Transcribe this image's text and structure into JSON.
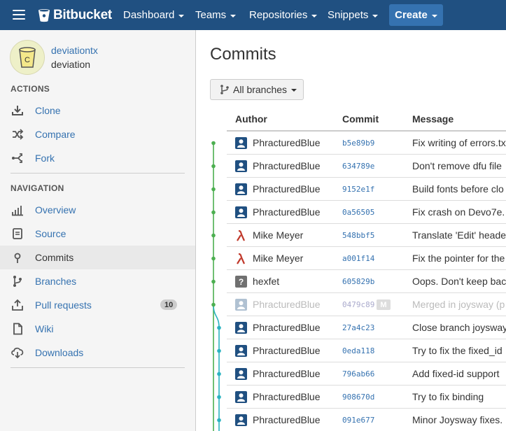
{
  "nav": {
    "brand": "Bitbucket",
    "items": [
      "Dashboard",
      "Teams",
      "Repositories",
      "Snippets"
    ],
    "create_label": "Create"
  },
  "repo": {
    "owner": "deviationtx",
    "name": "deviation",
    "avatar_letter": "C"
  },
  "sidebar": {
    "actions_title": "ACTIONS",
    "actions": [
      {
        "label": "Clone",
        "icon": "download-icon"
      },
      {
        "label": "Compare",
        "icon": "compare-icon"
      },
      {
        "label": "Fork",
        "icon": "fork-icon"
      }
    ],
    "navigation_title": "NAVIGATION",
    "navigation": [
      {
        "label": "Overview",
        "icon": "bar-chart-icon"
      },
      {
        "label": "Source",
        "icon": "source-icon"
      },
      {
        "label": "Commits",
        "icon": "commit-icon",
        "active": true
      },
      {
        "label": "Branches",
        "icon": "branch-icon"
      },
      {
        "label": "Pull requests",
        "icon": "pull-request-icon",
        "badge": "10"
      },
      {
        "label": "Wiki",
        "icon": "wiki-icon"
      },
      {
        "label": "Downloads",
        "icon": "cloud-download-icon"
      }
    ]
  },
  "main": {
    "title": "Commits",
    "branch_filter": "All branches",
    "columns": {
      "author": "Author",
      "commit": "Commit",
      "message": "Message"
    },
    "commits": [
      {
        "author": "PhracturedBlue",
        "hash": "b5e89b9",
        "message": "Fix writing of errors.txt",
        "avatar": "user",
        "lane": 0
      },
      {
        "author": "PhracturedBlue",
        "hash": "634789e",
        "message": "Don't remove dfu file",
        "avatar": "user",
        "lane": 0
      },
      {
        "author": "PhracturedBlue",
        "hash": "9152e1f",
        "message": "Build fonts before clo",
        "avatar": "user",
        "lane": 0
      },
      {
        "author": "PhracturedBlue",
        "hash": "0a56505",
        "message": "Fix crash on Devo7e.",
        "avatar": "user",
        "lane": 0
      },
      {
        "author": "Mike Meyer",
        "hash": "548bbf5",
        "message": "Translate 'Edit' heade",
        "avatar": "lambda",
        "lane": 0
      },
      {
        "author": "Mike Meyer",
        "hash": "a001f14",
        "message": "Fix the pointer for the",
        "avatar": "lambda",
        "lane": 0
      },
      {
        "author": "hexfet",
        "hash": "605829b",
        "message": "Oops. Don't keep bac",
        "avatar": "unknown",
        "lane": 0
      },
      {
        "author": "PhracturedBlue",
        "hash": "0479c89",
        "message": "Merged in joysway (p",
        "avatar": "user",
        "lane": 0,
        "merged": true,
        "tag": "M"
      },
      {
        "author": "PhracturedBlue",
        "hash": "27a4c23",
        "message": "Close branch joysway",
        "avatar": "user",
        "lane": 1
      },
      {
        "author": "PhracturedBlue",
        "hash": "0eda118",
        "message": "Try to fix the fixed_id",
        "avatar": "user",
        "lane": 1
      },
      {
        "author": "PhracturedBlue",
        "hash": "796ab66",
        "message": "Add fixed-id support",
        "avatar": "user",
        "lane": 1
      },
      {
        "author": "PhracturedBlue",
        "hash": "908670d",
        "message": "Try to fix binding",
        "avatar": "user",
        "lane": 1
      },
      {
        "author": "PhracturedBlue",
        "hash": "091e677",
        "message": "Minor Joysway fixes.",
        "avatar": "user",
        "lane": 1
      }
    ]
  },
  "colors": {
    "nav_bg": "#205081",
    "link": "#3572b0",
    "graph_main": "#4caf50",
    "graph_branch": "#2ab3c0",
    "lambda": "#c0392b"
  }
}
